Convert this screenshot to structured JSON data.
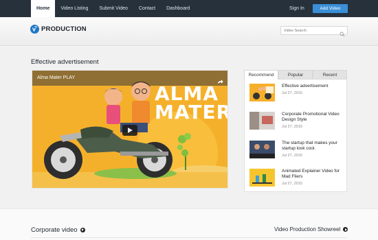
{
  "nav": {
    "items": [
      {
        "label": "Home"
      },
      {
        "label": "Video Listing"
      },
      {
        "label": "Submit Video"
      },
      {
        "label": "Contact"
      },
      {
        "label": "Dashboard"
      }
    ],
    "signin_label": "Sign In",
    "add_video_label": "Add Video"
  },
  "header": {
    "logo_text": "PRODUCTION",
    "search_placeholder": "Video Search"
  },
  "featured": {
    "section_title": "Effective advertisement",
    "video_title": "Alma Mater PLAY",
    "art_text_line1": "ALMA",
    "art_text_line2": "MATER"
  },
  "sidebar": {
    "tabs": [
      {
        "label": "Recommend"
      },
      {
        "label": "Popular"
      },
      {
        "label": "Recent"
      }
    ],
    "items": [
      {
        "title": "Effective advertisement",
        "date": "Jul 27, 2015"
      },
      {
        "title": "Corporate Promotional Video Design Style",
        "date": "Jul 27, 2015"
      },
      {
        "title": "The startup that makes your startup look cool.",
        "date": "Jul 27, 2015"
      },
      {
        "title": "Animated Explainer Video for Mad Fliers",
        "date": "Jul 27, 2015"
      }
    ]
  },
  "sections": {
    "corporate_label": "Corporate video",
    "showreel_label": "Video Production Showreel"
  },
  "colors": {
    "topbar": "#27313c",
    "accent": "#3a8fd8",
    "video_bg": "#f7b52e"
  }
}
